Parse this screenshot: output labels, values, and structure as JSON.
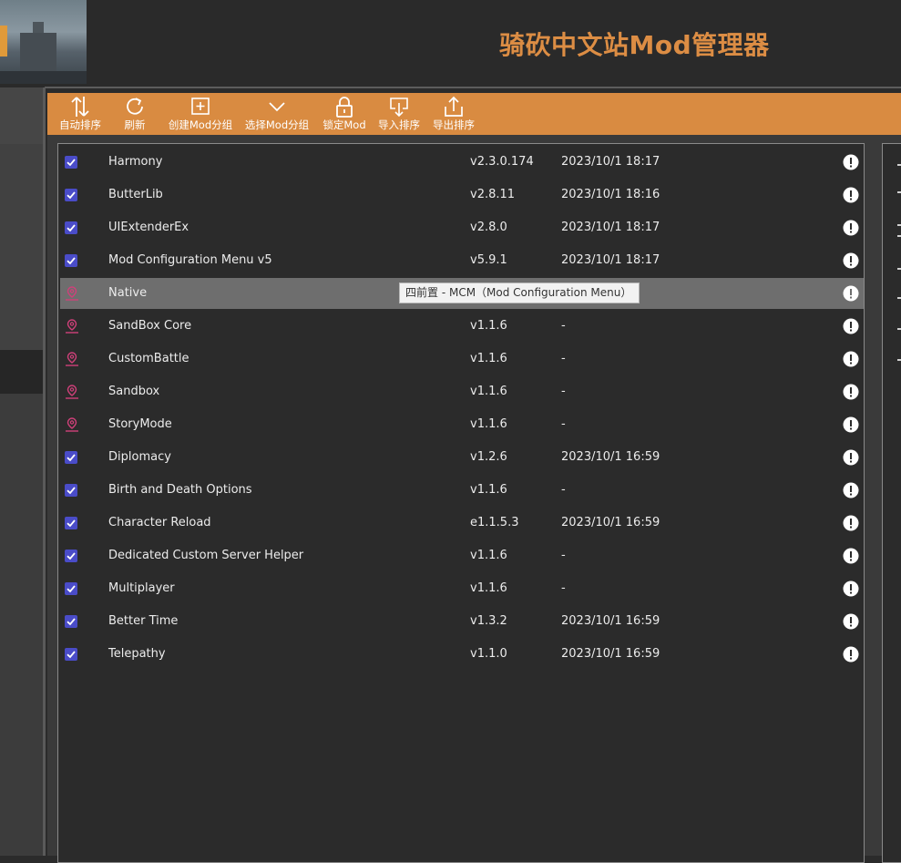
{
  "app": {
    "title": "骑砍中文站Mod管理器"
  },
  "colors": {
    "accent": "#d98b41",
    "checkbox": "#4a4cc8",
    "pin": "#d0407a",
    "selected_row": "#6e6e6e"
  },
  "toolbar": {
    "buttons": [
      {
        "label": "自动排序",
        "icon": "sort-arrows-icon"
      },
      {
        "label": "刷新",
        "icon": "refresh-icon"
      },
      {
        "label": "创建Mod分组",
        "icon": "add-group-icon"
      },
      {
        "label": "选择Mod分组",
        "icon": "chevron-down-icon"
      },
      {
        "label": "锁定Mod",
        "icon": "lock-icon"
      },
      {
        "label": "导入排序",
        "icon": "import-icon"
      },
      {
        "label": "导出排序",
        "icon": "export-icon"
      }
    ]
  },
  "mods": [
    {
      "name": "Harmony",
      "version": "v2.3.0.174",
      "date": "2023/10/1 18:17",
      "state": "checked"
    },
    {
      "name": "ButterLib",
      "version": "v2.8.11",
      "date": "2023/10/1 18:16",
      "state": "checked"
    },
    {
      "name": "UIExtenderEx",
      "version": "v2.8.0",
      "date": "2023/10/1 18:17",
      "state": "checked"
    },
    {
      "name": "Mod Configuration Menu v5",
      "version": "v5.9.1",
      "date": "2023/10/1 18:17",
      "state": "checked"
    },
    {
      "name": "Native",
      "version": "",
      "date": "",
      "state": "pinned",
      "selected": true
    },
    {
      "name": "SandBox Core",
      "version": "v1.1.6",
      "date": "-",
      "state": "pinned"
    },
    {
      "name": "CustomBattle",
      "version": "v1.1.6",
      "date": "-",
      "state": "pinned"
    },
    {
      "name": "Sandbox",
      "version": "v1.1.6",
      "date": "-",
      "state": "pinned"
    },
    {
      "name": "StoryMode",
      "version": "v1.1.6",
      "date": "-",
      "state": "pinned"
    },
    {
      "name": "Diplomacy",
      "version": "v1.2.6",
      "date": "2023/10/1 16:59",
      "state": "checked"
    },
    {
      "name": "Birth and Death Options",
      "version": "v1.1.6",
      "date": "-",
      "state": "checked"
    },
    {
      "name": "Character Reload",
      "version": "e1.1.5.3",
      "date": "2023/10/1 16:59",
      "state": "checked"
    },
    {
      "name": "Dedicated Custom Server Helper",
      "version": "v1.1.6",
      "date": "-",
      "state": "checked"
    },
    {
      "name": "Multiplayer",
      "version": "v1.1.6",
      "date": "-",
      "state": "checked"
    },
    {
      "name": "Better Time",
      "version": "v1.3.2",
      "date": "2023/10/1 16:59",
      "state": "checked"
    },
    {
      "name": "Telepathy",
      "version": "v1.1.0",
      "date": "2023/10/1 16:59",
      "state": "checked"
    }
  ],
  "tooltip": {
    "text": "四前置 - MCM（Mod Configuration Menu）"
  }
}
